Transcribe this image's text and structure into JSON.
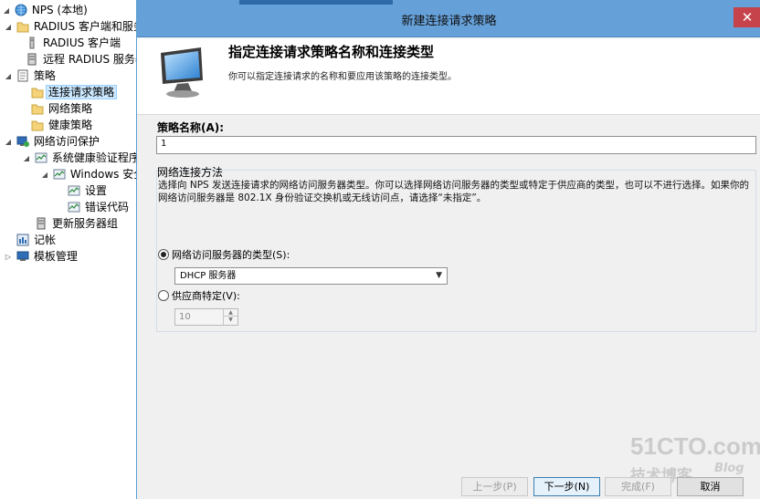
{
  "tree": {
    "items": [
      {
        "label": "NPS (本地)",
        "icon": "nps-globe-icon",
        "arrow": "◢"
      },
      {
        "label": "RADIUS 客户端和服务器",
        "icon": "folder-icon",
        "arrow": "◢"
      },
      {
        "label": "RADIUS 客户端",
        "icon": "client-list-icon",
        "arrow": ""
      },
      {
        "label": "远程 RADIUS 服务器组",
        "icon": "server-group-icon",
        "arrow": ""
      },
      {
        "label": "策略",
        "icon": "policy-icon",
        "arrow": "◢"
      },
      {
        "label": "连接请求策略",
        "icon": "folder-icon",
        "arrow": ""
      },
      {
        "label": "网络策略",
        "icon": "folder-icon",
        "arrow": ""
      },
      {
        "label": "健康策略",
        "icon": "folder-icon",
        "arrow": ""
      },
      {
        "label": "网络访问保护",
        "icon": "nap-icon",
        "arrow": "◢"
      },
      {
        "label": "系统健康验证程序",
        "icon": "validator-icon",
        "arrow": "◢"
      },
      {
        "label": "Windows 安全健康验证程序",
        "icon": "validator-icon",
        "arrow": "◢"
      },
      {
        "label": "设置",
        "icon": "validator-icon",
        "arrow": ""
      },
      {
        "label": "错误代码",
        "icon": "validator-icon",
        "arrow": ""
      },
      {
        "label": "更新服务器组",
        "icon": "server-group-icon",
        "arrow": ""
      },
      {
        "label": "记帐",
        "icon": "accounting-icon",
        "arrow": ""
      },
      {
        "label": "模板管理",
        "icon": "template-icon",
        "arrow": "▷"
      }
    ],
    "selected_index": 5
  },
  "dialog": {
    "title": "新建连接请求策略",
    "close_glyph": "✕",
    "header_title": "指定连接请求策略名称和连接类型",
    "header_subtitle": "你可以指定连接请求的名称和要应用该策略的连接类型。",
    "policy_name_label": "策略名称(A):",
    "policy_name_value": "1",
    "method_label": "网络连接方法",
    "method_description": "选择向 NPS 发送连接请求的网络访问服务器类型。你可以选择网络访问服务器的类型或特定于供应商的类型，也可以不进行选择。如果你的网络访问服务器是 802.1X 身份验证交换机或无线访问点，请选择“未指定”。",
    "radio_server_type_label": "网络访问服务器的类型(S):",
    "radio_server_type_selected": true,
    "server_type_value": "DHCP 服务器",
    "radio_vendor_label": "供应商特定(V):",
    "radio_vendor_selected": false,
    "vendor_value": "10",
    "buttons": {
      "back": "上一步(P)",
      "next": "下一步(N)",
      "finish": "完成(F)",
      "cancel": "取消"
    }
  },
  "watermark": {
    "main": "51CTO.com",
    "sub": "技术博客",
    "blog": "Blog"
  },
  "colors": {
    "titlebar": "#65a0d8",
    "close_button": "#c7434b",
    "selection": "#cce8ff"
  }
}
